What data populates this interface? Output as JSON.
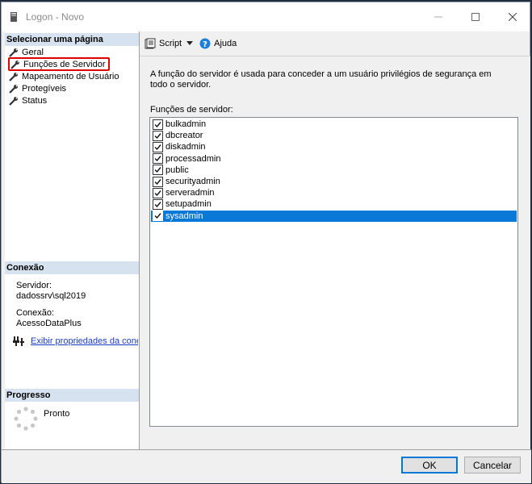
{
  "window": {
    "title": "Logon - Novo"
  },
  "left": {
    "select_page_header": "Selecionar uma página",
    "nav": [
      "Geral",
      "Funções de Servidor",
      "Mapeamento de Usuário",
      "Protegíveis",
      "Status"
    ],
    "connection_header": "Conexão",
    "server_label": "Servidor:",
    "server_value": "dadossrv\\sql2019",
    "connection_label": "Conexão:",
    "connection_value": "AcessoDataPlus",
    "view_props_link": "Exibir propriedades da conexão",
    "progress_header": "Progresso",
    "progress_status": "Pronto"
  },
  "toolbar": {
    "script_label": "Script",
    "help_label": "Ajuda"
  },
  "main": {
    "description": "A função do servidor é usada para conceder a um usuário privilégios de segurança em todo o servidor.",
    "roles_label": "Funções de servidor:",
    "roles": [
      {
        "name": "bulkadmin",
        "checked": true
      },
      {
        "name": "dbcreator",
        "checked": true
      },
      {
        "name": "diskadmin",
        "checked": true
      },
      {
        "name": "processadmin",
        "checked": true
      },
      {
        "name": "public",
        "checked": true
      },
      {
        "name": "securityadmin",
        "checked": true
      },
      {
        "name": "serveradmin",
        "checked": true
      },
      {
        "name": "setupadmin",
        "checked": true
      },
      {
        "name": "sysadmin",
        "checked": true,
        "selected": true
      }
    ]
  },
  "buttons": {
    "ok": "OK",
    "cancel": "Cancelar"
  },
  "colors": {
    "selection": "#0a78d7",
    "highlight_box": "#e00000",
    "section_header": "#d6e2ef",
    "link": "#1a3cc8"
  }
}
